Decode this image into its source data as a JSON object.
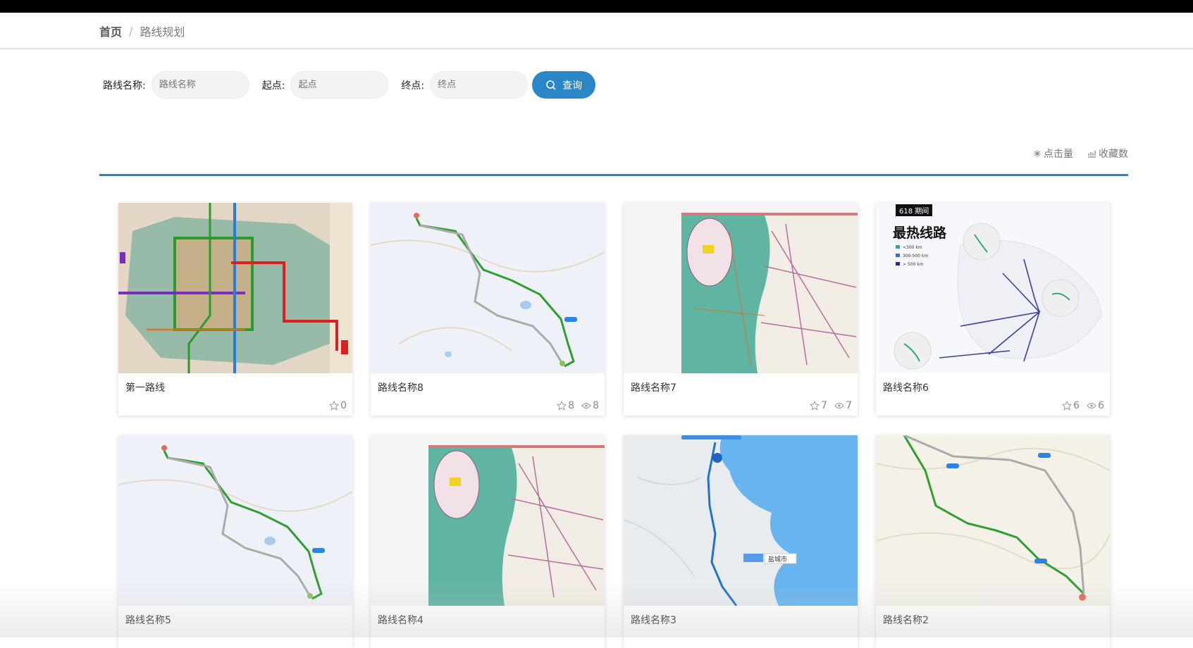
{
  "breadcrumb": {
    "home": "首页",
    "separator": "/",
    "current": "路线规划"
  },
  "search": {
    "name_label": "路线名称:",
    "name_placeholder": "路线名称",
    "start_label": "起点:",
    "start_placeholder": "起点",
    "end_label": "终点:",
    "end_placeholder": "终点",
    "button_label": "查询"
  },
  "sort": {
    "clicks_label": "点击量",
    "favorites_label": "收藏数"
  },
  "colors": {
    "accent": "#2a86c6",
    "divider": "#2d7fbf"
  },
  "cards": [
    {
      "name": "第一路线",
      "stars": "0",
      "views": "",
      "thumb": "metro"
    },
    {
      "name": "路线名称8",
      "stars": "8",
      "views": "8",
      "thumb": "route"
    },
    {
      "name": "路线名称7",
      "stars": "7",
      "views": "7",
      "thumb": "atlas"
    },
    {
      "name": "路线名称6",
      "stars": "6",
      "views": "6",
      "thumb": "hot"
    },
    {
      "name": "路线名称5",
      "stars": "",
      "views": "",
      "thumb": "route"
    },
    {
      "name": "路线名称4",
      "stars": "",
      "views": "",
      "thumb": "atlas"
    },
    {
      "name": "路线名称3",
      "stars": "",
      "views": "",
      "thumb": "sea"
    },
    {
      "name": "路线名称2",
      "stars": "",
      "views": "",
      "thumb": "route2"
    }
  ],
  "hot_map": {
    "tag": "618 期间",
    "title": "最热线路",
    "legend": [
      "<300 km",
      "300-500 km",
      "> 500 km"
    ]
  },
  "sea_map": {
    "label": "盐城市"
  }
}
